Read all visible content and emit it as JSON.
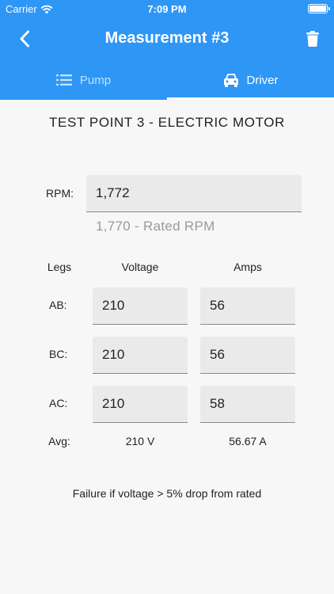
{
  "status_bar": {
    "carrier": "Carrier",
    "time": "7:09 PM"
  },
  "header": {
    "title": "Measurement #3"
  },
  "tabs": [
    {
      "label": "Pump",
      "icon": "list-icon",
      "active": false
    },
    {
      "label": "Driver",
      "icon": "car-icon",
      "active": true
    }
  ],
  "test_point": {
    "title": "TEST POINT 3 - ELECTRIC MOTOR"
  },
  "rpm": {
    "label": "RPM:",
    "value": "1,772",
    "rated_hint": "1,770 - Rated RPM"
  },
  "legs_table": {
    "headers": {
      "legs": "Legs",
      "voltage": "Voltage",
      "amps": "Amps"
    },
    "rows": [
      {
        "leg": "AB:",
        "voltage": "210",
        "amps": "56"
      },
      {
        "leg": "BC:",
        "voltage": "210",
        "amps": "56"
      },
      {
        "leg": "AC:",
        "voltage": "210",
        "amps": "58"
      }
    ],
    "avg": {
      "label": "Avg:",
      "voltage": "210 V",
      "amps": "56.67 A"
    }
  },
  "footer_note": "Failure if voltage > 5% drop from rated",
  "colors": {
    "primary": "#2e96f5",
    "background": "#f7f7f7",
    "field": "#eaeaea"
  }
}
